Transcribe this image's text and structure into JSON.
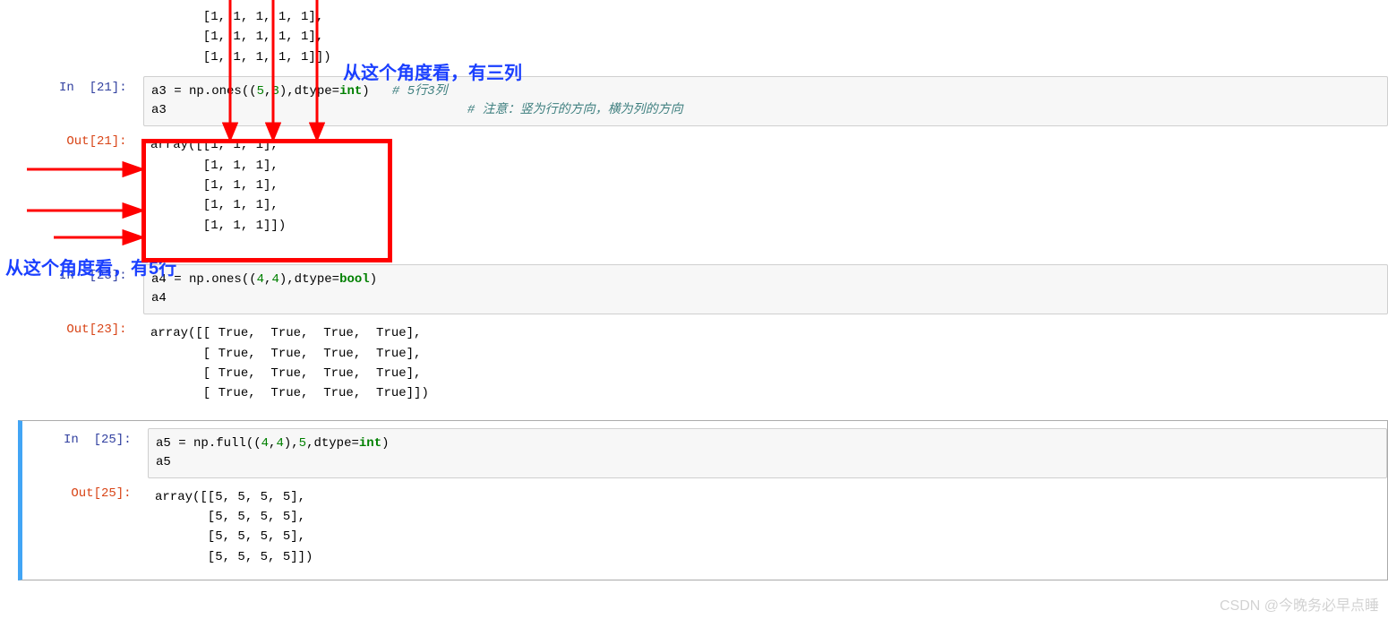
{
  "prompts": {
    "in21": "In  [21]: ",
    "out21": "Out[21]: ",
    "in23": "In  [23]: ",
    "out23": "Out[23]: ",
    "in25": "In  [25]: ",
    "out25": "Out[25]: "
  },
  "code": {
    "top_output_frag": "       [1, 1, 1, 1, 1],\n       [1, 1, 1, 1, 1],\n       [1, 1, 1, 1, 1]])",
    "in21_a3": "a3",
    "in21_eq": " = np.ones((",
    "in21_5": "5",
    "in21_c1": ",",
    "in21_3": "3",
    "in21_mid": "),dtype=",
    "in21_int": "int",
    "in21_end": ")   ",
    "in21_com1": "# 5行3列",
    "in21_line2": "a3                                        ",
    "in21_com2": "# 注意：竖为行的方向，横为列的方向",
    "out21_text": "array([[1, 1, 1],\n       [1, 1, 1],\n       [1, 1, 1],\n       [1, 1, 1],\n       [1, 1, 1]])",
    "in23_a4": "a4",
    "in23_eq": " = np.ones((",
    "in23_4a": "4",
    "in23_c1": ",",
    "in23_4b": "4",
    "in23_mid": "),dtype=",
    "in23_bool": "bool",
    "in23_end": ")",
    "in23_line2": "a4",
    "out23_text": "array([[ True,  True,  True,  True],\n       [ True,  True,  True,  True],\n       [ True,  True,  True,  True],\n       [ True,  True,  True,  True]])",
    "in25_a5": "a5",
    "in25_eq": " = np.full((",
    "in25_4a": "4",
    "in25_c1": ",",
    "in25_4b": "4",
    "in25_mid": "),",
    "in25_5": "5",
    "in25_mid2": ",dtype=",
    "in25_int": "int",
    "in25_end": ")",
    "in25_line2": "a5",
    "out25_text": "array([[5, 5, 5, 5],\n       [5, 5, 5, 5],\n       [5, 5, 5, 5],\n       [5, 5, 5, 5]])"
  },
  "annotations": {
    "top_label": "从这个角度看，有三列",
    "left_label": "从这个角度看，有5行"
  },
  "watermark": "CSDN @今晚务必早点睡"
}
